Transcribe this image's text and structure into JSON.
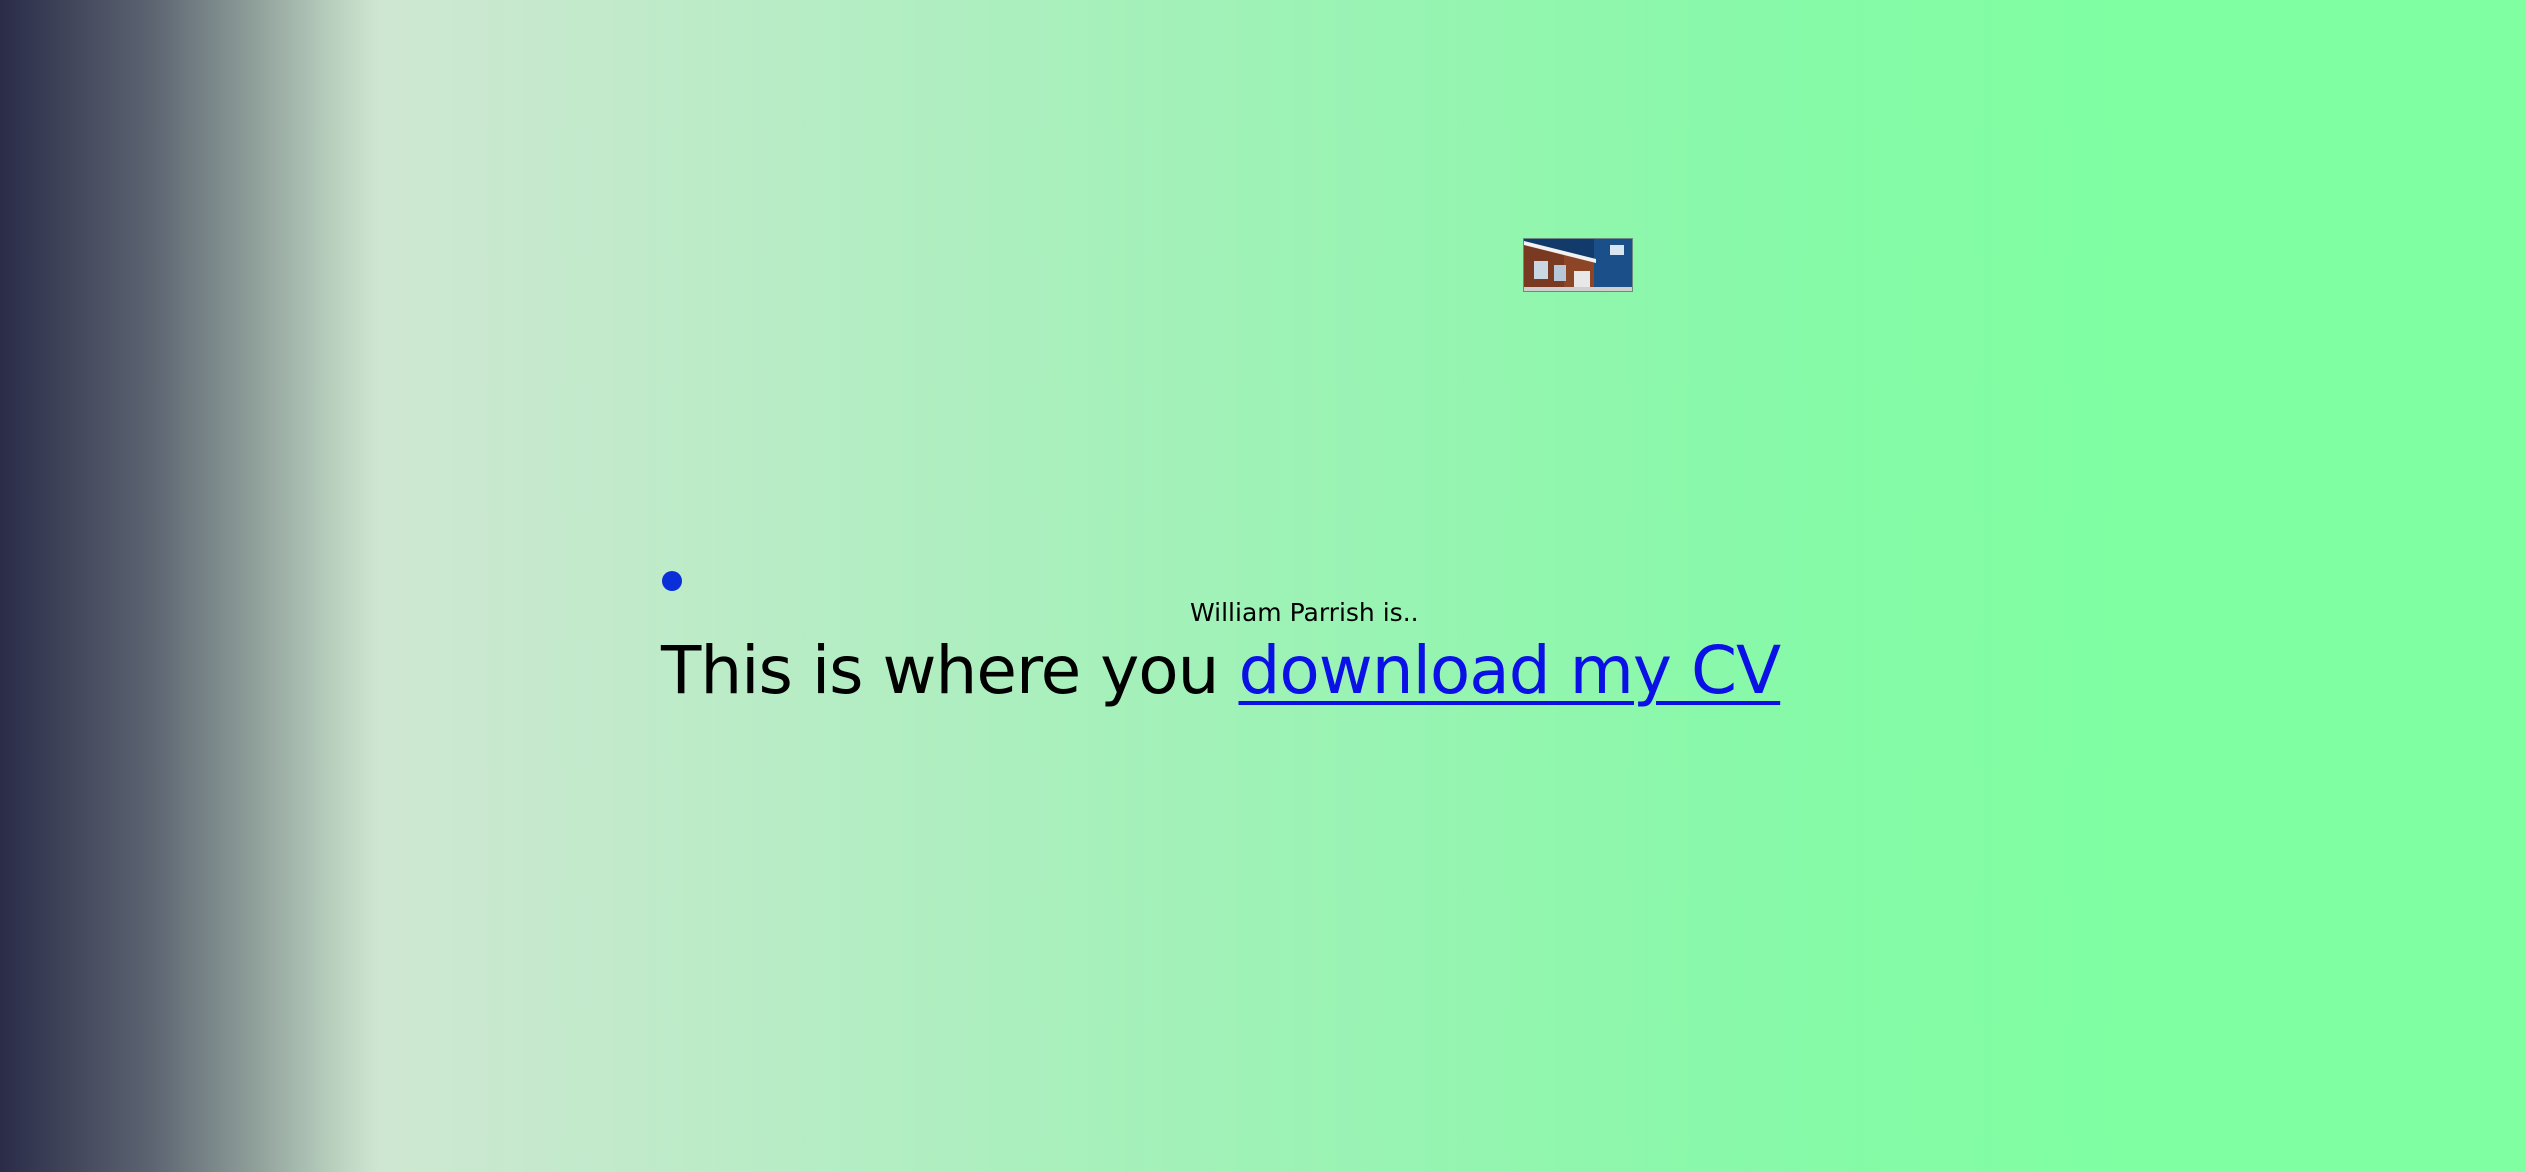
{
  "hero": {
    "subtitle": "William Parrish is..",
    "headline_text": "This is where you",
    "link_text": "download my CV"
  },
  "colors": {
    "accent_dot": "#0a2fd8",
    "link": "#0a10e6",
    "background_start": "#2a2c48",
    "background_end": "#7fffa2"
  },
  "thumbnail": {
    "icon": "building-photo"
  }
}
